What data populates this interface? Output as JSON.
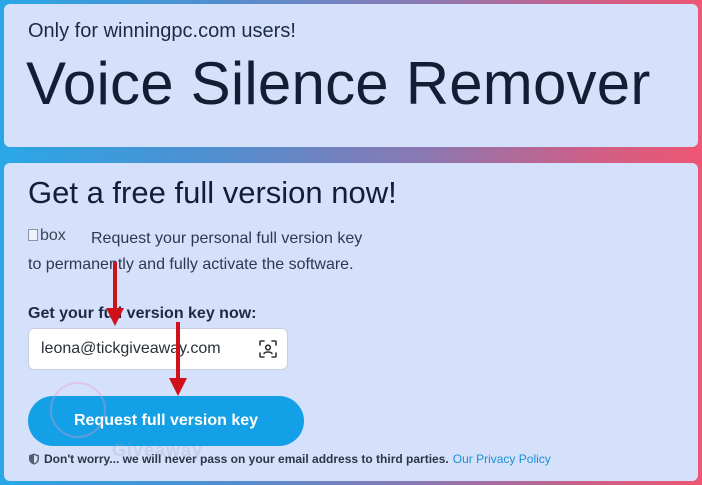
{
  "promo": {
    "only_for": "Only for winningpc.com users!",
    "app_title": "Voice Silence Remover"
  },
  "offer": {
    "headline": "Get a free full version now!",
    "box_alt": "box",
    "desc_line1": "Request your personal full version key",
    "desc_line2": "to permanently and fully activate the software.",
    "key_label": "Get your full version key now:",
    "email_value": "leona@tickgiveaway.com",
    "request_button": "Request full version key",
    "privacy_text": "Don't worry... we will never pass on your email address to third parties.",
    "privacy_link": "Our Privacy Policy"
  },
  "watermark": "Giveaway",
  "colors": {
    "card_bg": "#d5e1fb",
    "button_bg": "#14a0e6",
    "arrow": "#d0101a",
    "link": "#1b8fd6"
  },
  "icons": {
    "scan": "face-scan-icon",
    "shield": "shield-icon",
    "arrows": "annotation-arrow-icon"
  }
}
